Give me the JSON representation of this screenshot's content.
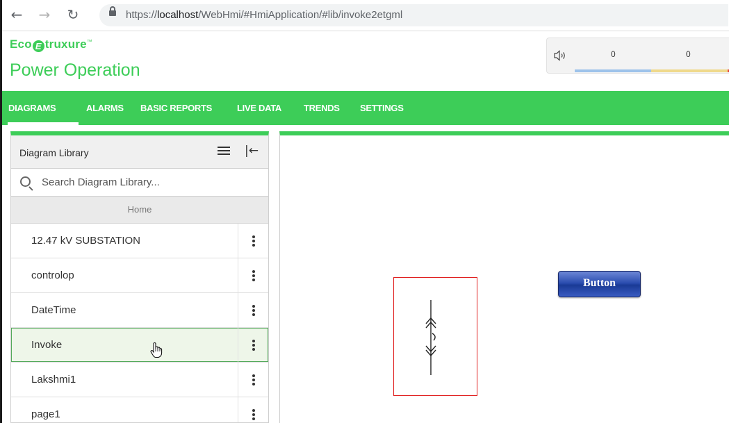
{
  "browser": {
    "url_prefix": "https://",
    "url_host": "localhost",
    "url_path": "/WebHmi/#HmiApplication/#lib/invoke2etgml"
  },
  "header": {
    "brand_eco": "Eco",
    "brand_e": "E",
    "brand_truxure": "truxure",
    "tm": "™",
    "title": "Power Operation"
  },
  "alarms": {
    "counts": [
      "0",
      "0"
    ],
    "colors": [
      "#9ec3ea",
      "#efd98c",
      "#e8463c"
    ]
  },
  "nav": {
    "tabs": [
      {
        "label": "DIAGRAMS",
        "active": true
      },
      {
        "label": "ALARMS"
      },
      {
        "label": "BASIC REPORTS"
      },
      {
        "label": "LIVE DATA"
      },
      {
        "label": "TRENDS"
      },
      {
        "label": "SETTINGS"
      }
    ]
  },
  "library": {
    "title": "Diagram Library",
    "search_placeholder": "Search Diagram Library...",
    "home_label": "Home",
    "items": [
      {
        "label": "12.47 kV SUBSTATION"
      },
      {
        "label": "controlop"
      },
      {
        "label": "DateTime"
      },
      {
        "label": "Invoke",
        "selected": true
      },
      {
        "label": "Lakshmi1"
      },
      {
        "label": "page1"
      }
    ]
  },
  "canvas": {
    "button_label": "Button"
  },
  "colors": {
    "accent": "#3dcd58",
    "symbol_border": "#e02020"
  }
}
